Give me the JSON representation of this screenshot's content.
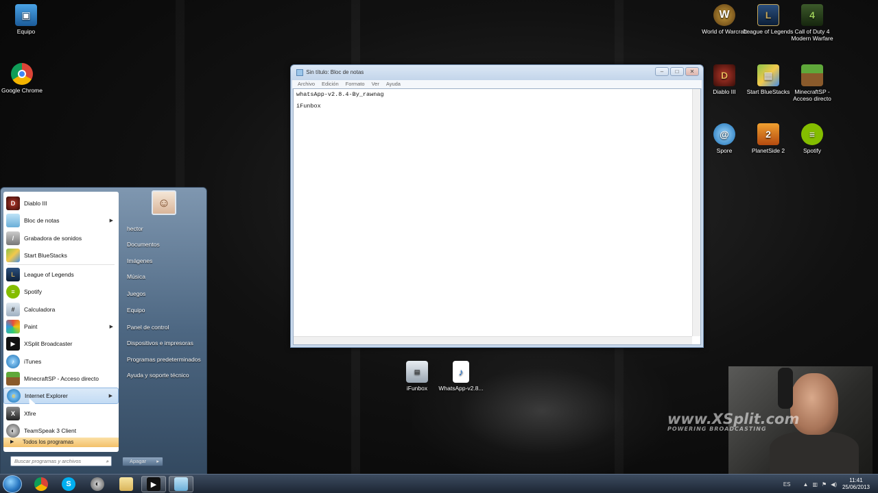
{
  "desktop_icons": {
    "equipo": "Equipo",
    "chrome": "Google Chrome",
    "wow": "World of Warcraft",
    "lol": "League of Legends",
    "cod4": "Call of Duty 4 Modern Warfare",
    "diablo": "Diablo III",
    "bluestacks": "Start BlueStacks",
    "minecraft": "MinecraftSP - Acceso directo",
    "spore": "Spore",
    "planetside": "PlanetSide 2",
    "spotify": "Spotify",
    "ifunbox": "iFunbox",
    "whatsapp": "WhatsApp-v2.8..."
  },
  "notepad": {
    "title": "Sin título: Bloc de notas",
    "menu": [
      "Archivo",
      "Edición",
      "Formato",
      "Ver",
      "Ayuda"
    ],
    "lines": [
      "whatsApp-v2.8.4-By_rawnag",
      "iFunbox"
    ]
  },
  "start_menu": {
    "programs": [
      "Diablo III",
      "Bloc de notas",
      "Grabadora de sonidos",
      "Start BlueStacks",
      "League of Legends",
      "Spotify",
      "Calculadora",
      "Paint",
      "XSplit Broadcaster",
      "iTunes",
      "MinecraftSP - Acceso directo",
      "Internet Explorer",
      "Xfire",
      "TeamSpeak 3 Client"
    ],
    "all_programs": "Todos los programas",
    "search_placeholder": "Buscar programas y archivos",
    "right_items": [
      "hector",
      "Documentos",
      "Imágenes",
      "Música",
      "Juegos",
      "Equipo",
      "Panel de control",
      "Dispositivos e impresoras",
      "Programas predeterminados",
      "Ayuda y soporte técnico"
    ],
    "shutdown": "Apagar"
  },
  "taskbar": {
    "language": "ES",
    "time": "11:41",
    "date": "25/06/2013"
  },
  "watermark": {
    "brand": "www.XSplit.com",
    "tagline": "POWERING BROADCASTING"
  },
  "colors": {
    "taskbar": "#1c2634",
    "startmenu": "#4d6782",
    "highlight": "#c2dbf4"
  }
}
